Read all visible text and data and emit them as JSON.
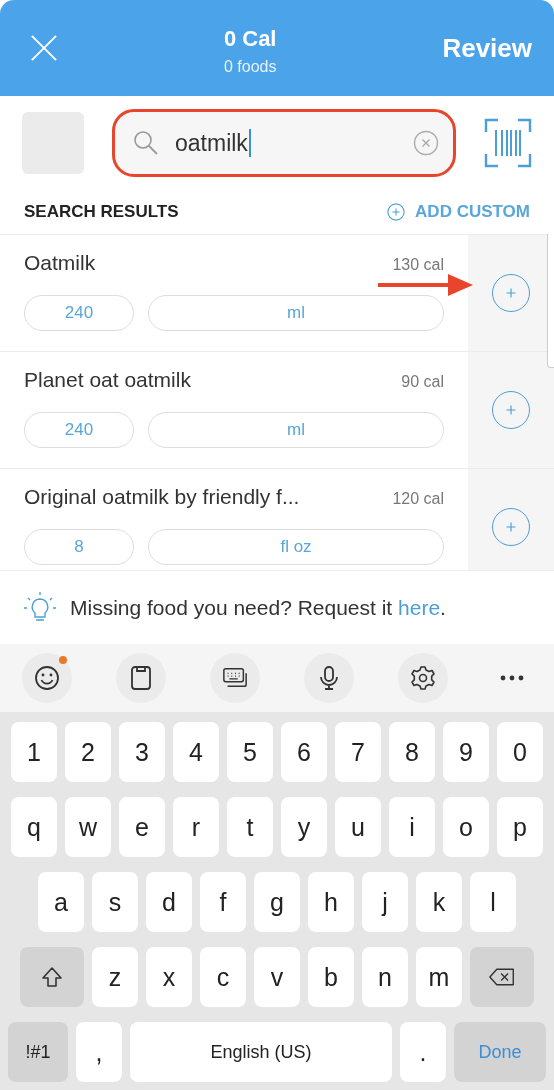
{
  "header": {
    "calories": "0 Cal",
    "foods": "0 foods",
    "action": "Review"
  },
  "search": {
    "value": "oatmilk",
    "highlighted": true
  },
  "results": {
    "title": "SEARCH RESULTS",
    "add_custom": "ADD CUSTOM",
    "items": [
      {
        "name": "Oatmilk",
        "calories": "130 cal",
        "amount": "240",
        "unit": "ml",
        "annotated": true
      },
      {
        "name": "Planet oat oatmilk",
        "calories": "90 cal",
        "amount": "240",
        "unit": "ml",
        "annotated": false
      },
      {
        "name": "Original oatmilk by friendly f...",
        "calories": "120 cal",
        "amount": "8",
        "unit": "fl oz",
        "annotated": false
      }
    ]
  },
  "hint": {
    "text": "Missing food you need? Request it ",
    "link": "here",
    "end": "."
  },
  "toolbar": [
    {
      "kind": "emoji",
      "badge": true
    },
    {
      "kind": "clipboard",
      "badge": false
    },
    {
      "kind": "keyboard",
      "badge": false
    },
    {
      "kind": "mic",
      "badge": false
    },
    {
      "kind": "settings",
      "badge": false
    },
    {
      "kind": "more",
      "badge": false
    }
  ],
  "keyboard": {
    "rows": [
      {
        "keys": [
          "1",
          "2",
          "3",
          "4",
          "5",
          "6",
          "7",
          "8",
          "9",
          "0"
        ]
      },
      {
        "keys": [
          "q",
          "w",
          "e",
          "r",
          "t",
          "y",
          "u",
          "i",
          "o",
          "p"
        ]
      },
      {
        "keys": [
          "a",
          "s",
          "d",
          "f",
          "g",
          "h",
          "j",
          "k",
          "l"
        ]
      },
      {
        "keys": [
          {
            "kind": "shift"
          },
          "z",
          "x",
          "c",
          "v",
          "b",
          "n",
          "m",
          {
            "kind": "backspace"
          }
        ]
      },
      {
        "keys": [
          {
            "kind": "symbols",
            "label": "!#1"
          },
          {
            "kind": "char",
            "label": ","
          },
          {
            "kind": "space",
            "label": "English (US)"
          },
          {
            "kind": "char",
            "label": "."
          },
          {
            "kind": "done",
            "label": "Done"
          }
        ]
      }
    ]
  }
}
